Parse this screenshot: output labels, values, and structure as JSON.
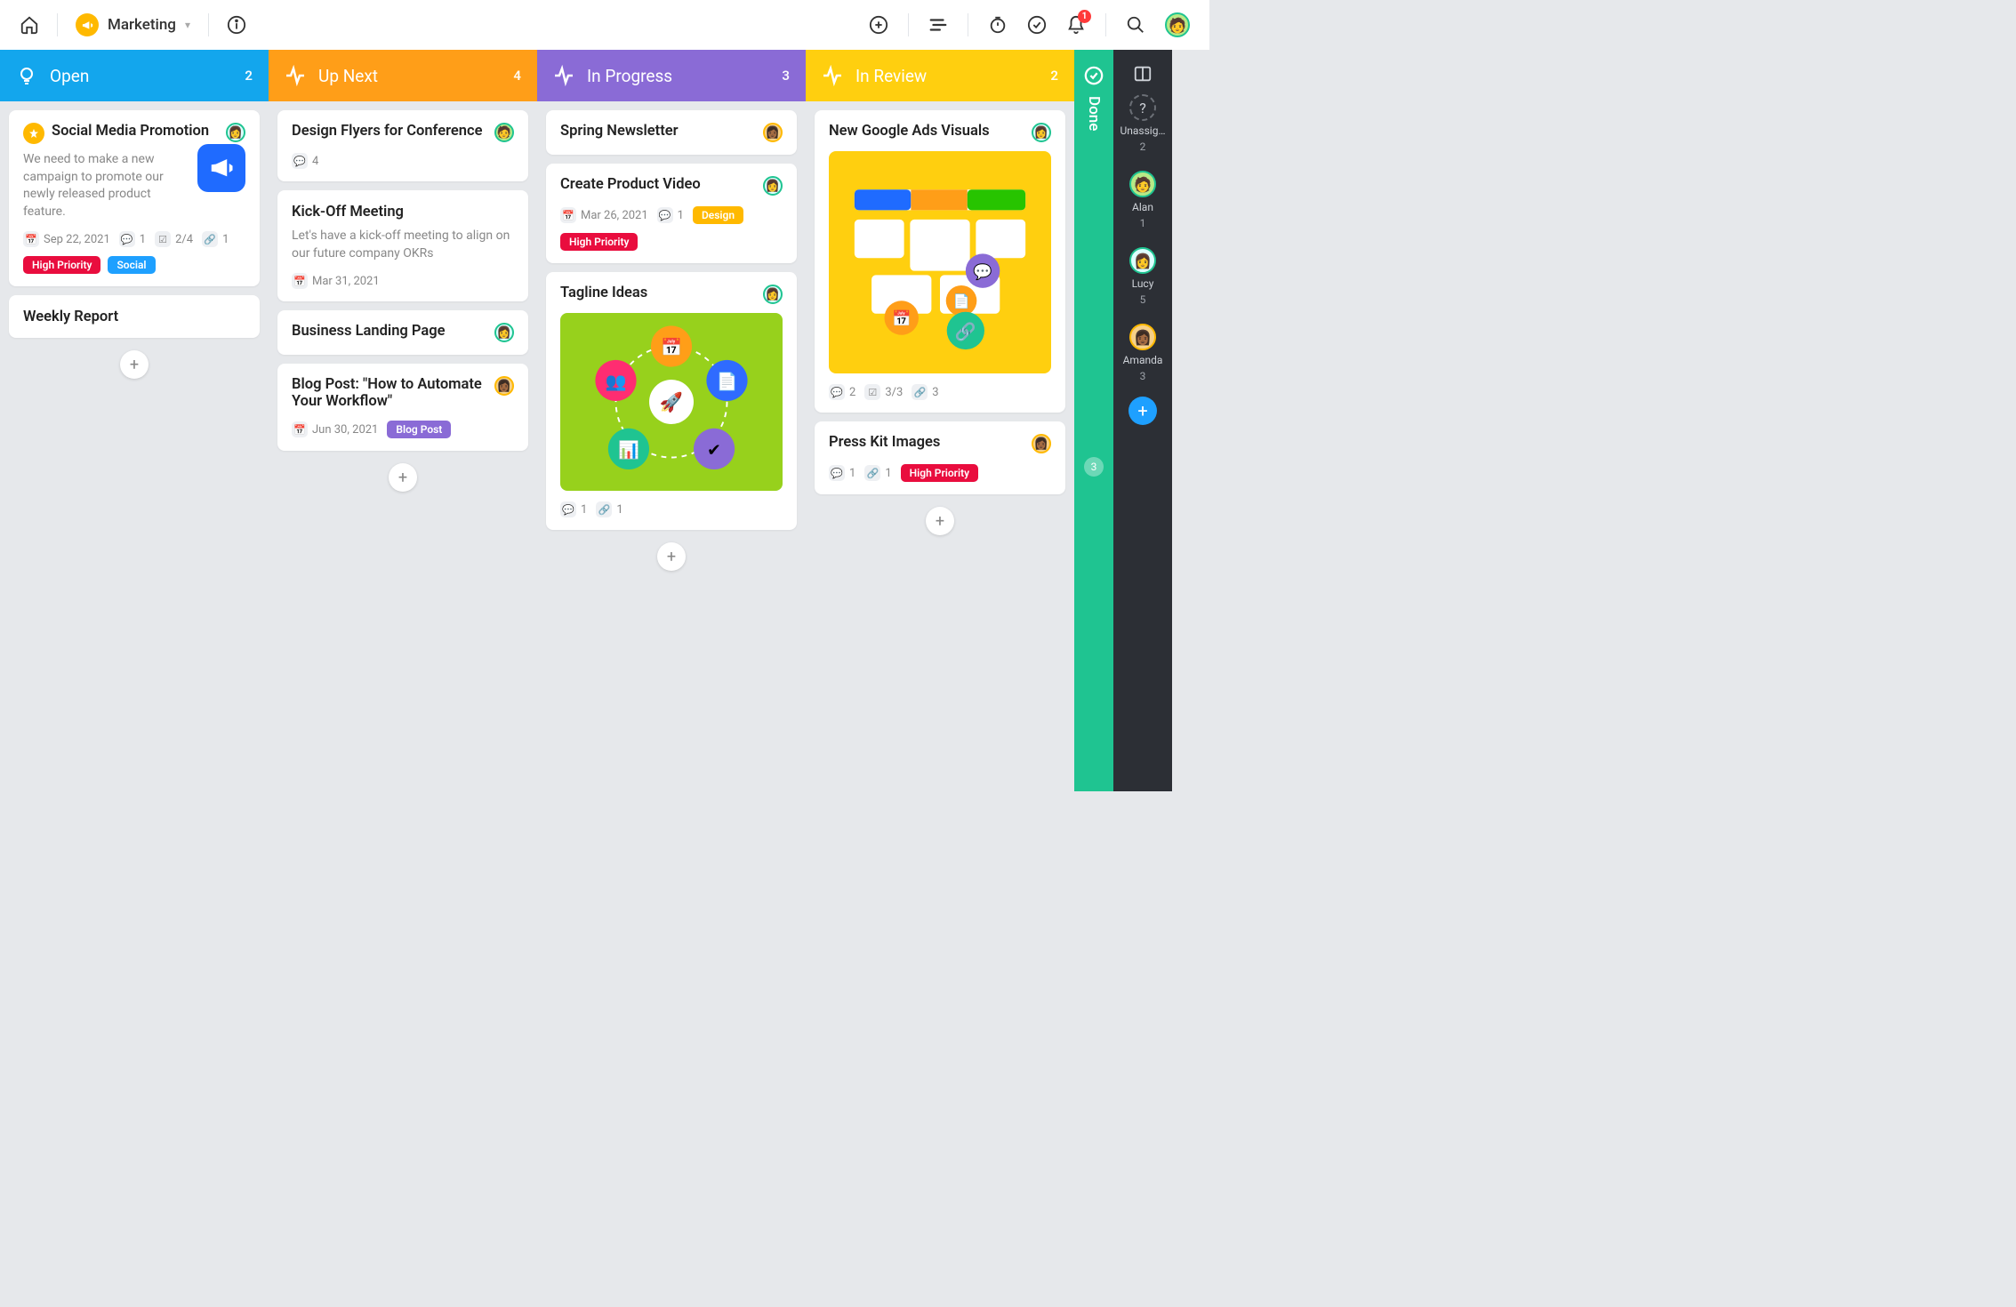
{
  "header": {
    "project_name": "Marketing",
    "notification_count": "1"
  },
  "columns": [
    {
      "id": "open",
      "title": "Open",
      "count": "2",
      "color": "#13a6ed",
      "cards": [
        {
          "title": "Social Media Promotion",
          "pinned": true,
          "assignee": "lucy",
          "desc": "We need to make a new campaign to promote our newly released product feature.",
          "promo_icon": true,
          "date": "Sep 22, 2021",
          "comments": "1",
          "checklist": "2/4",
          "links": "1",
          "tags": [
            {
              "text": "High Priority",
              "color": "red"
            },
            {
              "text": "Social",
              "color": "blue"
            }
          ]
        },
        {
          "title": "Weekly Report"
        }
      ]
    },
    {
      "id": "upnext",
      "title": "Up Next",
      "count": "4",
      "color": "#ff9e18",
      "cards": [
        {
          "title": "Design Flyers for Conference",
          "assignee": "alan",
          "comments": "4"
        },
        {
          "title": "Kick-Off Meeting",
          "desc": "Let's have a kick-off meeting to align on our future company OKRs",
          "date": "Mar 31, 2021"
        },
        {
          "title": "Business Landing Page",
          "assignee": "lucy"
        },
        {
          "title": "Blog Post: \"How to Automate Your Workflow\"",
          "assignee": "amanda",
          "date": "Jun 30, 2021",
          "tags": [
            {
              "text": "Blog Post",
              "color": "purple"
            }
          ]
        }
      ]
    },
    {
      "id": "inprogress",
      "title": "In Progress",
      "count": "3",
      "color": "#8a6bd6",
      "cards": [
        {
          "title": "Spring Newsletter",
          "assignee": "amanda"
        },
        {
          "title": "Create Product Video",
          "assignee": "lucy",
          "date": "Mar 26, 2021",
          "comments": "1",
          "tags_inline": [
            {
              "text": "Design",
              "color": "orange"
            }
          ],
          "tags": [
            {
              "text": "High Priority",
              "color": "red"
            }
          ]
        },
        {
          "title": "Tagline Ideas",
          "assignee": "lucy",
          "image": "green",
          "comments": "1",
          "links": "1"
        }
      ]
    },
    {
      "id": "inreview",
      "title": "In Review",
      "count": "2",
      "color": "#ffcf0f",
      "cards": [
        {
          "title": "New Google Ads Visuals",
          "assignee": "lucy",
          "image": "yellow",
          "comments": "2",
          "checklist": "3/3",
          "links": "3"
        },
        {
          "title": "Press Kit Images",
          "assignee": "amanda",
          "comments": "1",
          "links": "1",
          "tags_inline": [
            {
              "text": "High Priority",
              "color": "red"
            }
          ]
        }
      ]
    }
  ],
  "done": {
    "label": "Done",
    "count": "3"
  },
  "sidebar": [
    {
      "name": "Unassig…",
      "count": "2",
      "avatar": "unassigned"
    },
    {
      "name": "Alan",
      "count": "1",
      "avatar": "alan"
    },
    {
      "name": "Lucy",
      "count": "5",
      "avatar": "lucy"
    },
    {
      "name": "Amanda",
      "count": "3",
      "avatar": "amanda"
    }
  ]
}
